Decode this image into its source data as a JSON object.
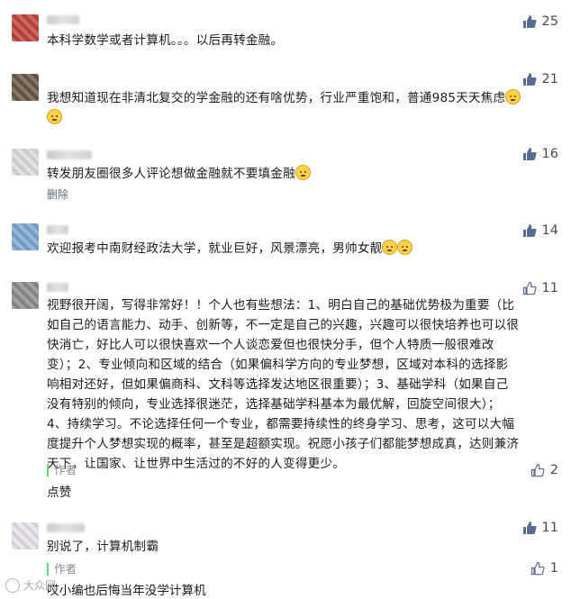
{
  "comments": [
    {
      "text": "本科学数学或者计算机。。。以后再转金融。",
      "likes": "25"
    },
    {
      "text": "我想知道现在非清北复交的学金融的还有啥优势，行业严重饱和，普通985天天焦虑",
      "likes": "21"
    },
    {
      "text": "转发朋友圈很多人评论想做金融就不要填金融",
      "likes": "16",
      "delete_label": "删除"
    },
    {
      "text": "欢迎报考中南财经政法大学，就业巨好，风景漂亮，男帅女靓",
      "likes": "14"
    },
    {
      "lines": [
        "视野很开阔，写得非常好！！个人也有些想法：1、明白自己的基础优势极为重要（比",
        "如自己的语言能力、动手、创新等，不一定是自己的兴趣，兴趣可以很快培养也可以很",
        "快消亡，好比人可以很快喜欢一个人谈恋爱但也很快分手，但个人特质一般很难改",
        "变）；2、专业倾向和区域的结合（如果偏科学方向的专业梦想，区域对本科的选择影",
        "响相对还好，但如果偏商科、文科等选择发达地区很重要）；3、基础学科（如果自己",
        "没有特别的倾向，专业选择很迷茫，选择基础学科基本为最优解，回旋空间很大）；",
        "4、持续学习。不论选择任何一个专业，都需要持续性的终身学习、思考，这可以大幅",
        "度提升个人梦想实现的概率，甚至是超额实现。祝愿小孩子们都能梦想成真，达则兼济",
        "天下，让国家、让世界中生活过的不好的人变得更少。"
      ],
      "likes": "11",
      "author_tag": "作者",
      "reply": "点赞",
      "reply_likes": "2"
    },
    {
      "text": "别说了，计算机制霸",
      "likes": "11",
      "author_tag": "作者",
      "reply": "小编也后悔当年没学计算机",
      "reply_prefix": "哎",
      "reply_likes": "1"
    }
  ],
  "watermark": "大众网",
  "colors": {
    "like_filled": "#576b95",
    "like_outline": "#576b95",
    "author_bar": "#6ad06e"
  }
}
